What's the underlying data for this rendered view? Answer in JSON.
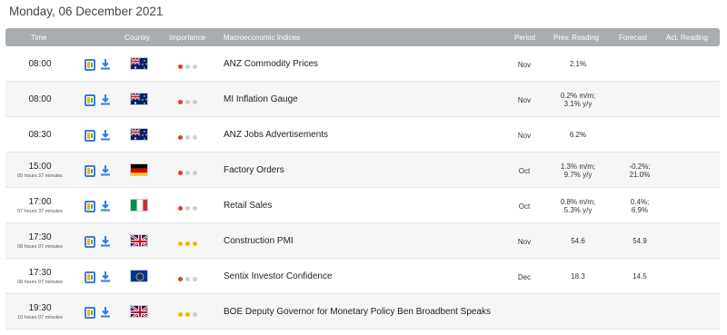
{
  "date_title": "Monday, 06 December 2021",
  "headers": {
    "time": "Time",
    "country": "Country",
    "importance": "Importance",
    "indices": "Macroeconomic Indices",
    "period": "Period",
    "prev": "Prev. Reading",
    "forecast": "Forecast",
    "actual": "Act. Reading"
  },
  "colors": {
    "high": "#e53935",
    "medium": "#f5b400",
    "low": "#cfcfcf",
    "header_bg": "#a9acb0"
  },
  "icons": {
    "calendar": "calendar-add-icon",
    "download": "download-icon"
  },
  "events": [
    {
      "time": "08:00",
      "sub": "",
      "flag": "au",
      "importance": 1,
      "name": "ANZ Commodity Prices",
      "period": "Nov",
      "prev": "2.1%",
      "forecast": ""
    },
    {
      "time": "08:00",
      "sub": "",
      "flag": "au",
      "importance": 1,
      "name": "MI Inflation Gauge",
      "period": "Nov",
      "prev": "0.2% m/m;\n3.1% y/y",
      "forecast": ""
    },
    {
      "time": "08:30",
      "sub": "",
      "flag": "au",
      "importance": 1,
      "name": "ANZ Jobs Advertisements",
      "period": "Nov",
      "prev": "6.2%",
      "forecast": ""
    },
    {
      "time": "15:00",
      "sub": "05 hours 37 minutes",
      "flag": "de",
      "importance": 1,
      "name": "Factory Orders",
      "period": "Oct",
      "prev": "1.3% m/m;\n9.7% y/y",
      "forecast": "-0.2%;\n21.0%"
    },
    {
      "time": "17:00",
      "sub": "07 hours 37 minutes",
      "flag": "it",
      "importance": 1,
      "name": "Retail Sales",
      "period": "Oct",
      "prev": "0.8% m/m;\n5.3% y/y",
      "forecast": "0.4%;\n6.9%"
    },
    {
      "time": "17:30",
      "sub": "08 hours 07 minutes",
      "flag": "gb",
      "importance": 3,
      "name": "Construction PMI",
      "period": "Nov",
      "prev": "54.6",
      "forecast": "54.9"
    },
    {
      "time": "17:30",
      "sub": "08 hours 07 minutes",
      "flag": "eu",
      "importance": 1,
      "name": "Sentix Investor Confidence",
      "period": "Dec",
      "prev": "18.3",
      "forecast": "14.5"
    },
    {
      "time": "19:30",
      "sub": "10 hours 07 minutes",
      "flag": "gb",
      "importance": 2,
      "name": "BOE Deputy Governor for Monetary Policy Ben Broadbent Speaks",
      "period": "",
      "prev": "",
      "forecast": ""
    }
  ]
}
